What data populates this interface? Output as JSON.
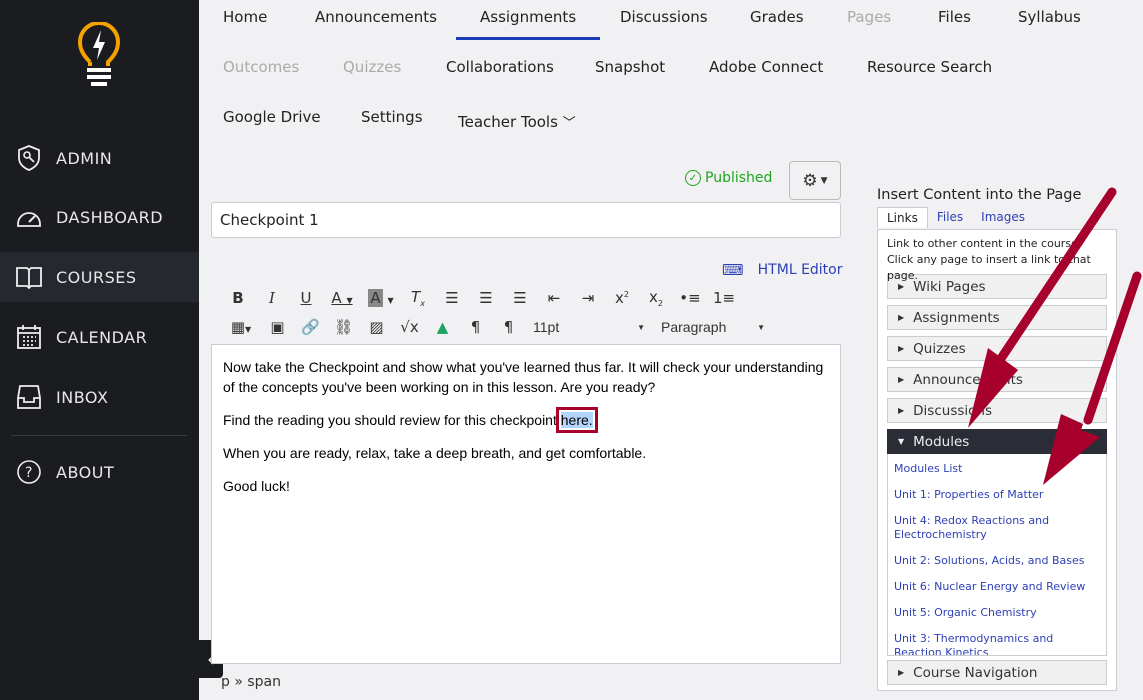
{
  "sidebar": {
    "items": [
      {
        "label": "ADMIN",
        "icon": "shield-key-icon"
      },
      {
        "label": "DASHBOARD",
        "icon": "speedometer-icon"
      },
      {
        "label": "COURSES",
        "icon": "book-icon",
        "active": true
      },
      {
        "label": "CALENDAR",
        "icon": "calendar-icon"
      },
      {
        "label": "INBOX",
        "icon": "inbox-icon"
      },
      {
        "label": "ABOUT",
        "icon": "question-icon"
      }
    ],
    "logo_color": "#f5a200"
  },
  "course_nav": {
    "tabs": [
      {
        "label": "Home"
      },
      {
        "label": "Announcements"
      },
      {
        "label": "Assignments",
        "active": true
      },
      {
        "label": "Discussions"
      },
      {
        "label": "Grades"
      },
      {
        "label": "Pages",
        "disabled": true
      },
      {
        "label": "Files"
      },
      {
        "label": "Syllabus"
      },
      {
        "label": "Outcomes",
        "disabled": true
      },
      {
        "label": "Quizzes",
        "disabled": true
      },
      {
        "label": "Collaborations"
      },
      {
        "label": "Snapshot"
      },
      {
        "label": "Adobe Connect"
      },
      {
        "label": "Resource Search"
      },
      {
        "label": "Google Drive"
      },
      {
        "label": "Settings"
      },
      {
        "label": "Teacher Tools"
      }
    ]
  },
  "editor": {
    "status": "Published",
    "title_value": "Checkpoint 1",
    "html_editor_label": "HTML Editor",
    "font_size": "11pt",
    "block_format": "Paragraph",
    "paragraphs": [
      "Now take the Checkpoint and show what you've learned thus far. It will check your understanding of the concepts you've been working on in this lesson. Are you ready?",
      "Find the reading you should review for this checkpoint ",
      "When you are ready, relax, take a deep breath, and get comfortable.",
      "Good luck!"
    ],
    "selected_link_text": "here.",
    "element_path": "p » span"
  },
  "panel": {
    "title": "Insert Content into the Page",
    "tabs": [
      "Links",
      "Files",
      "Images"
    ],
    "description": "Link to other content in the course. Click any page to insert a link to that page.",
    "sections": [
      "Wiki Pages",
      "Assignments",
      "Quizzes",
      "Announcements",
      "Discussions",
      "Modules",
      "Course Navigation"
    ],
    "modules": [
      "Modules List",
      "Unit 1: Properties of Matter",
      "Unit 4: Redox Reactions and Electrochemistry",
      "Unit 2: Solutions, Acids, and Bases",
      "Unit 6: Nuclear Energy and Review",
      "Unit 5: Organic Chemistry",
      "Unit 3: Thermodynamics and Reaction Kinetics"
    ]
  },
  "colors": {
    "accent": "#1a3db5",
    "published": "#1fa51f",
    "annotation": "#a8002d",
    "link": "#2d3fb6"
  }
}
